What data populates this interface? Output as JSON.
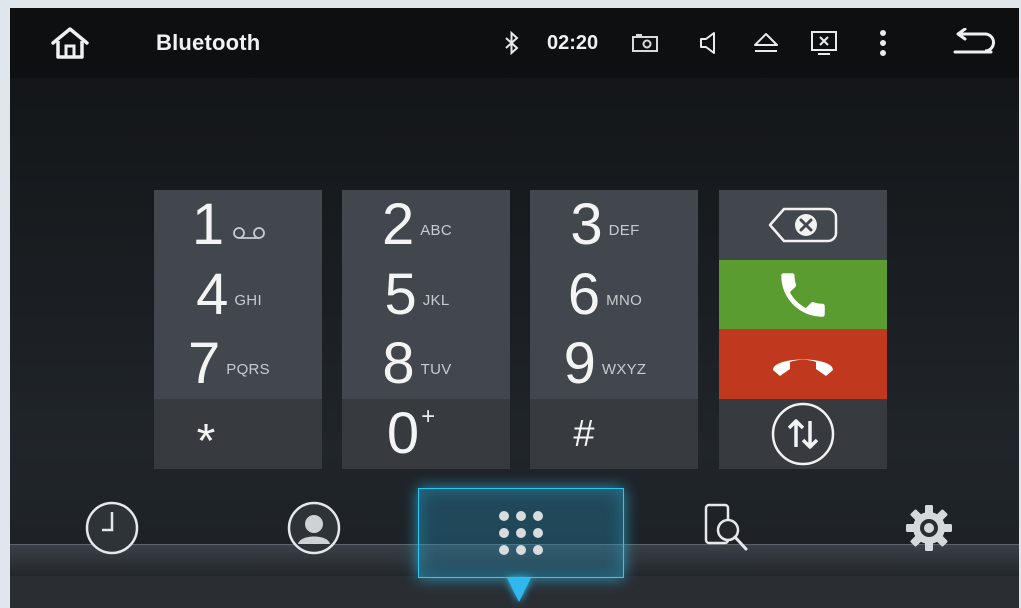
{
  "status_bar": {
    "title": "Bluetooth",
    "time": "02:20",
    "icons": [
      "home-icon",
      "bluetooth-icon",
      "camera-icon",
      "volume-icon",
      "eject-icon",
      "screen-off-icon",
      "more-vert-icon",
      "back-icon"
    ]
  },
  "dialpad": {
    "keys": [
      {
        "digit": "1",
        "letters": "voicemail-icon"
      },
      {
        "digit": "2",
        "letters": "ABC"
      },
      {
        "digit": "3",
        "letters": "DEF"
      },
      {
        "digit": "4",
        "letters": "GHI"
      },
      {
        "digit": "5",
        "letters": "JKL"
      },
      {
        "digit": "6",
        "letters": "MNO"
      },
      {
        "digit": "7",
        "letters": "PQRS"
      },
      {
        "digit": "8",
        "letters": "TUV"
      },
      {
        "digit": "9",
        "letters": "WXYZ"
      },
      {
        "digit": "*",
        "letters": ""
      },
      {
        "digit": "0",
        "letters": "+"
      },
      {
        "digit": "#",
        "letters": ""
      }
    ],
    "controls": [
      "backspace-icon",
      "call-icon",
      "hang-up-icon",
      "swap-icon"
    ],
    "colors": {
      "call": "#5a9c30",
      "hang_up": "#c0391f",
      "key": "#42474d"
    }
  },
  "bottom_nav": {
    "items": [
      "history-icon",
      "contacts-icon",
      "dialpad-icon",
      "search-icon",
      "settings-icon"
    ],
    "active": "dialpad-icon",
    "accent": "#2cc6f5"
  }
}
